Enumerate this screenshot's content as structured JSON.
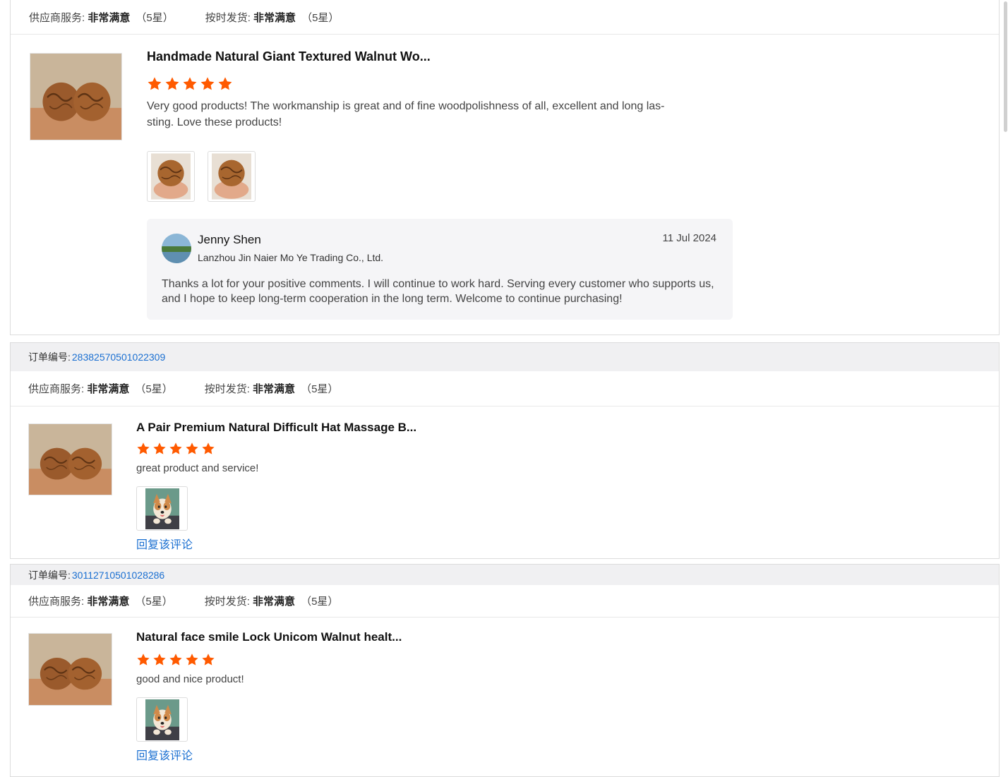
{
  "card1": {
    "rating": {
      "service_label": "供应商服务:",
      "service_value": "非常满意",
      "service_stars": "（5星）",
      "shipping_label": "按时发货:",
      "shipping_value": "非常满意",
      "shipping_stars": "（5星）"
    },
    "product": {
      "title": "Handmade Natural Giant Textured Walnut Wo...",
      "stars": 5,
      "review_line1": "Very good products! The workmanship is great and of fine woodpolishness of all, excellent and long las-",
      "review_line2": "sting. Love these products!"
    },
    "reply": {
      "name": "Jenny Shen",
      "company": "Lanzhou Jin Naier Mo Ye Trading Co., Ltd.",
      "date": "11 Jul 2024",
      "text_line1": "Thanks a lot for your positive comments. I will continue to work hard. Serving every customer who supports us,",
      "text_line2": "and I hope to keep long-term cooperation in the long term. Welcome to continue purchasing!"
    }
  },
  "card2": {
    "order_label": "订单编号:",
    "order_no": "28382570501022309",
    "rating": {
      "service_label": "供应商服务:",
      "service_value": "非常满意",
      "service_stars": "（5星）",
      "shipping_label": "按时发货:",
      "shipping_value": "非常满意",
      "shipping_stars": "（5星）"
    },
    "product": {
      "title": "A Pair Premium Natural Difficult Hat Massage B...",
      "stars": 5,
      "review": "great product and service!"
    },
    "reply_link": "回复该评论"
  },
  "card3": {
    "order_label": "订单编号:",
    "order_no": "30112710501028286",
    "rating": {
      "service_label": "供应商服务:",
      "service_value": "非常满意",
      "service_stars": "（5星）",
      "shipping_label": "按时发货:",
      "shipping_value": "非常满意",
      "shipping_stars": "（5星）"
    },
    "product": {
      "title": "Natural face smile Lock Unicom Walnut healt...",
      "stars": 5,
      "review": "good and nice product!"
    },
    "reply_link": "回复该评论"
  },
  "colors": {
    "star": "#ff5a00",
    "link": "#1a6fd1",
    "order_bar_bg": "#f0f0f2"
  }
}
